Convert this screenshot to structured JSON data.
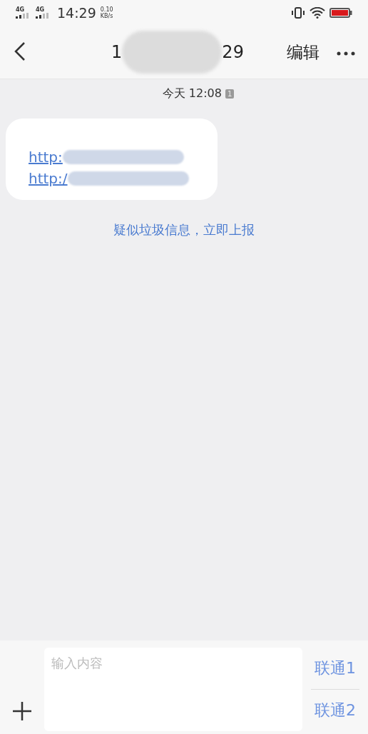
{
  "status_bar": {
    "network_1": "4G",
    "network_2": "4G",
    "time": "14:29",
    "speed_value": "0.10",
    "speed_unit": "KB/s"
  },
  "header": {
    "title_start": "1",
    "title_end": "29",
    "edit": "编辑"
  },
  "conversation": {
    "timestamp": "今天 12:08",
    "sim_badge": "1",
    "messages": [
      {
        "links": [
          "http:",
          "http:/"
        ]
      }
    ],
    "spam_report": "疑似垃圾信息，立即上报"
  },
  "composer": {
    "placeholder": "输入内容",
    "send_buttons": [
      "联通1",
      "联通2"
    ]
  }
}
